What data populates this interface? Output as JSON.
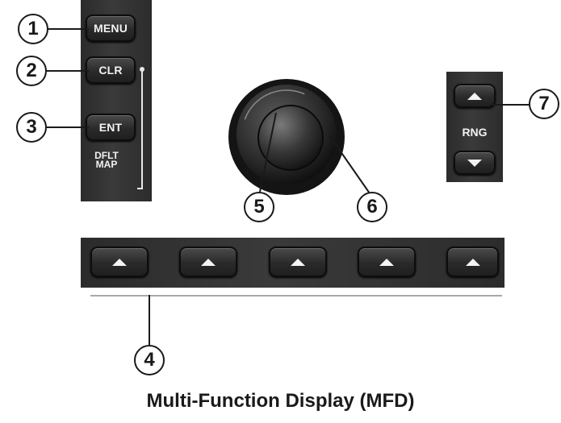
{
  "buttons": {
    "menu": "MENU",
    "clr": "CLR",
    "ent": "ENT",
    "dflt_map": "DFLT MAP",
    "rng": "RNG"
  },
  "callouts": [
    "1",
    "2",
    "3",
    "4",
    "5",
    "6",
    "7"
  ],
  "caption": "Multi-Function Display (MFD)",
  "softkey_count": 5
}
